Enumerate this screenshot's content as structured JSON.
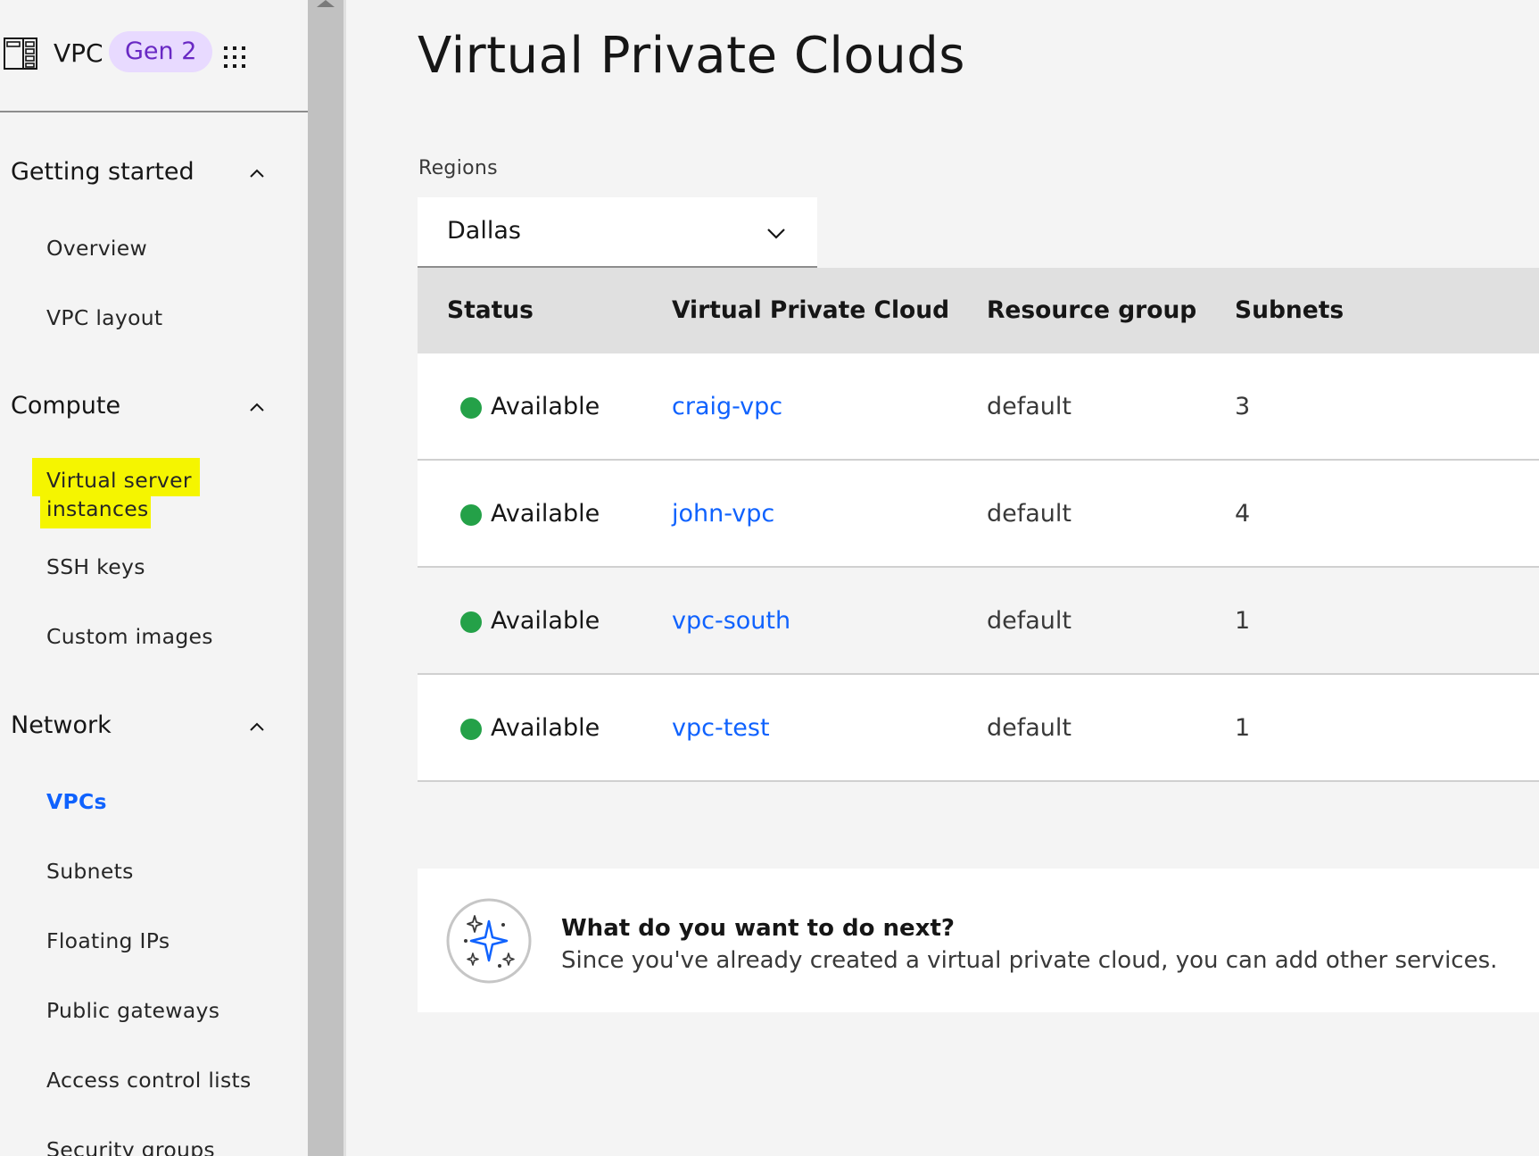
{
  "sidebar": {
    "product_name": "VPC",
    "generation_tag": "Gen 2",
    "sections": [
      {
        "label": "Getting started",
        "items": [
          "Overview",
          "VPC layout"
        ]
      },
      {
        "label": "Compute",
        "items": [
          "Virtual server",
          "instances",
          "SSH keys",
          "Custom images"
        ]
      },
      {
        "label": "Network",
        "items": [
          "VPCs",
          "Subnets",
          "Floating IPs",
          "Public gateways",
          "Access control lists",
          "Security groups"
        ]
      }
    ],
    "active_item": "VPCs",
    "highlighted_item": "Virtual server instances"
  },
  "main": {
    "title": "Virtual Private Clouds",
    "regions_label": "Regions",
    "region_selected": "Dallas",
    "table": {
      "headers": [
        "Status",
        "Virtual Private Cloud",
        "Resource group",
        "Subnets"
      ],
      "rows": [
        {
          "status": "Available",
          "name": "craig-vpc",
          "resource_group": "default",
          "subnets": "3"
        },
        {
          "status": "Available",
          "name": "john-vpc",
          "resource_group": "default",
          "subnets": "4"
        },
        {
          "status": "Available",
          "name": "vpc-south",
          "resource_group": "default",
          "subnets": "1"
        },
        {
          "status": "Available",
          "name": "vpc-test",
          "resource_group": "default",
          "subnets": "1"
        }
      ]
    },
    "next_steps": {
      "title": "What do you want to do next?",
      "description": "Since you've already created a virtual private cloud, you can add other services."
    }
  },
  "colors": {
    "accent_link": "#0f62fe",
    "status_available": "#24a148",
    "gen_tag_bg": "#e8daff",
    "gen_tag_text": "#6929c4",
    "highlight": "#f5f500"
  },
  "icons": [
    "vpc-icon",
    "app-switcher-icon",
    "chevron-up-icon",
    "chevron-down-icon",
    "status-dot-icon",
    "sparkle-icon"
  ]
}
